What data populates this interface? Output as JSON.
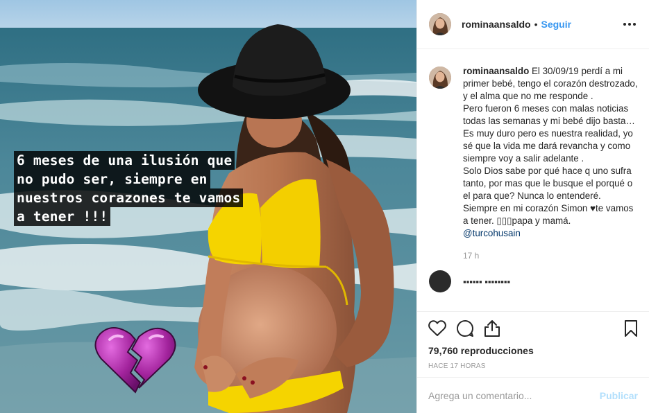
{
  "post": {
    "author": "rominaansaldo",
    "follow_label": "Seguir",
    "separator": "•",
    "media": {
      "story_lines": [
        "6 meses de una ilusión que",
        "no pudo ser, siempre en",
        "nuestros corazones te vamos",
        "a tener !!!"
      ],
      "sticker": "broken-heart-emoji"
    },
    "caption": {
      "user": "rominaansaldo",
      "paragraphs": [
        "El 30/09/19 perdí a mi primer bebé, tengo el corazón destrozado, y el alma que no me responde .",
        "Pero fueron 6 meses con malas noticias todas las semanas y mi bebé dijo basta…",
        "Es muy duro pero es nuestra realidad, yo sé que la vida me dará revancha y como siempre voy a salir adelante .",
        "Solo Dios sabe por qué hace q uno sufra tanto, por mas que le busque el porqué o el para que? Nunca lo entenderé."
      ],
      "last_line": "Siempre en mi corazón Simon ♥te vamos a tener. ▯▯▯papa y mamá.",
      "mention": "@turcohusain",
      "time": "17 h"
    },
    "next_comment_user": "▪▪▪▪▪▪ ▪▪▪▪▪▪▪▪",
    "views": "79,760 reproducciones",
    "posted_ago": "HACE 17 HORAS",
    "comment_box": {
      "placeholder": "Agrega un comentario...",
      "publish_label": "Publicar"
    },
    "icons": {
      "like": "heart-icon",
      "comment": "comment-bubble-icon",
      "share": "share-icon",
      "save": "bookmark-icon",
      "more": "more-options-icon"
    },
    "colors": {
      "link_blue": "#3897f0",
      "mention": "#003569",
      "publish_disabled": "#b2dffc",
      "muted": "#999999",
      "bikini_yellow": "#f5d400"
    }
  }
}
